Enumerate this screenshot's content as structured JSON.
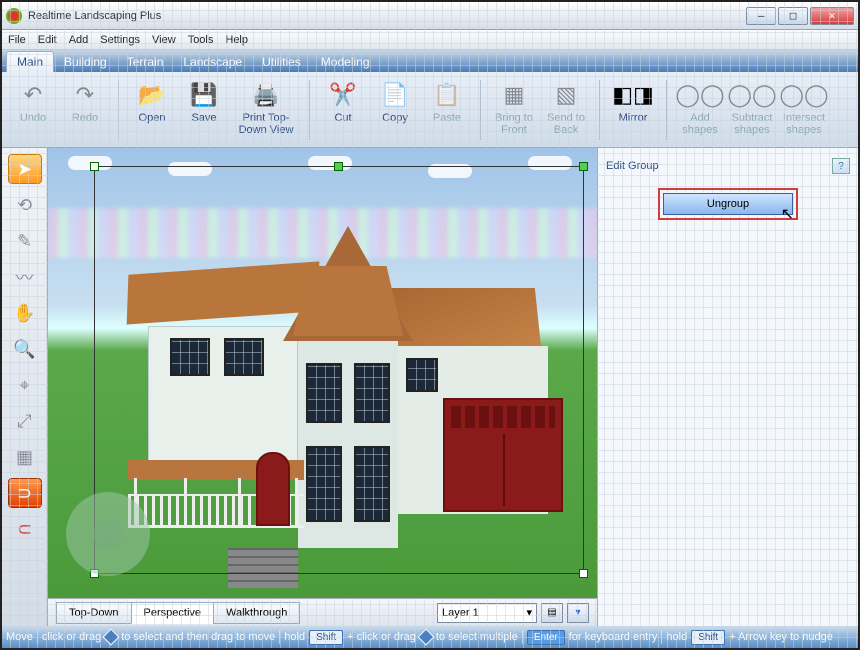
{
  "title": "Realtime Landscaping Plus",
  "menubar": [
    "File",
    "Edit",
    "Add",
    "Settings",
    "View",
    "Tools",
    "Help"
  ],
  "ribbon_tabs": [
    "Main",
    "Building",
    "Terrain",
    "Landscape",
    "Utilities",
    "Modeling"
  ],
  "ribbon": {
    "undo": "Undo",
    "redo": "Redo",
    "open": "Open",
    "save": "Save",
    "print": "Print Top-Down View",
    "cut": "Cut",
    "copy": "Copy",
    "paste": "Paste",
    "front": "Bring to Front",
    "back": "Send to Back",
    "mirror": "Mirror",
    "addshapes": "Add shapes",
    "subshapes": "Subtract shapes",
    "intshapes": "Intersect shapes"
  },
  "viewtabs": {
    "topdown": "Top-Down",
    "perspective": "Perspective",
    "walkthrough": "Walkthrough"
  },
  "layer": {
    "label": "Layer 1"
  },
  "panel": {
    "title": "Edit Group",
    "ungroup": "Ungroup",
    "help": "?"
  },
  "status": {
    "mode": "Move",
    "s1": "click or drag",
    "s2": "to select and then drag to move",
    "hold1": "hold",
    "shift": "Shift",
    "s3": "+ click or drag",
    "s4": "to select multiple",
    "enter": "Enter",
    "s5": "for keyboard entry",
    "hold2": "hold",
    "s6": "+ Arrow key to nudge"
  }
}
